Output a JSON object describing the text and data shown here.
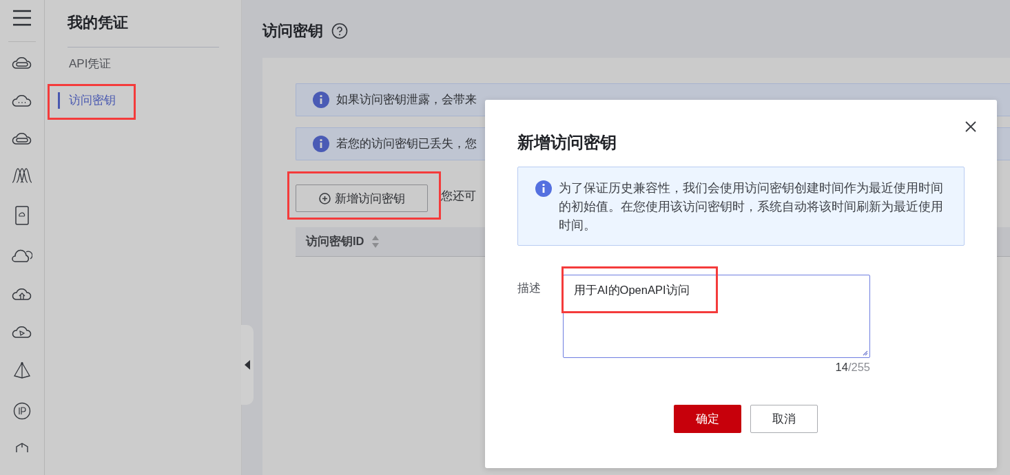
{
  "subnav": {
    "title": "我的凭证",
    "items": [
      {
        "label": "API凭证",
        "selected": false,
        "highlighted": false
      },
      {
        "label": "访问密钥",
        "selected": true,
        "highlighted": true
      }
    ]
  },
  "page": {
    "title": "访问密钥",
    "alerts": [
      {
        "text": "如果访问密钥泄露，会带来"
      },
      {
        "text": "若您的访问密钥已丢失，您"
      }
    ],
    "add_button": {
      "label": "新增访问密钥",
      "highlighted": true
    },
    "quota_note": "您还可",
    "table": {
      "columns": [
        "访问密钥ID"
      ]
    }
  },
  "dialog": {
    "title": "新增访问密钥",
    "info": "为了保证历史兼容性，我们会使用访问密钥创建时间作为最近使用时间的初始值。在您使用该访问密钥时，系统自动将该时间刷新为最近使用时间。",
    "field": {
      "label": "描述",
      "value": "用于AI的OpenAPI访问",
      "highlighted": true,
      "count": "14",
      "max": "/255"
    },
    "buttons": [
      {
        "label": "确定",
        "kind": "primary"
      },
      {
        "label": "取消",
        "kind": "secondary"
      }
    ]
  }
}
